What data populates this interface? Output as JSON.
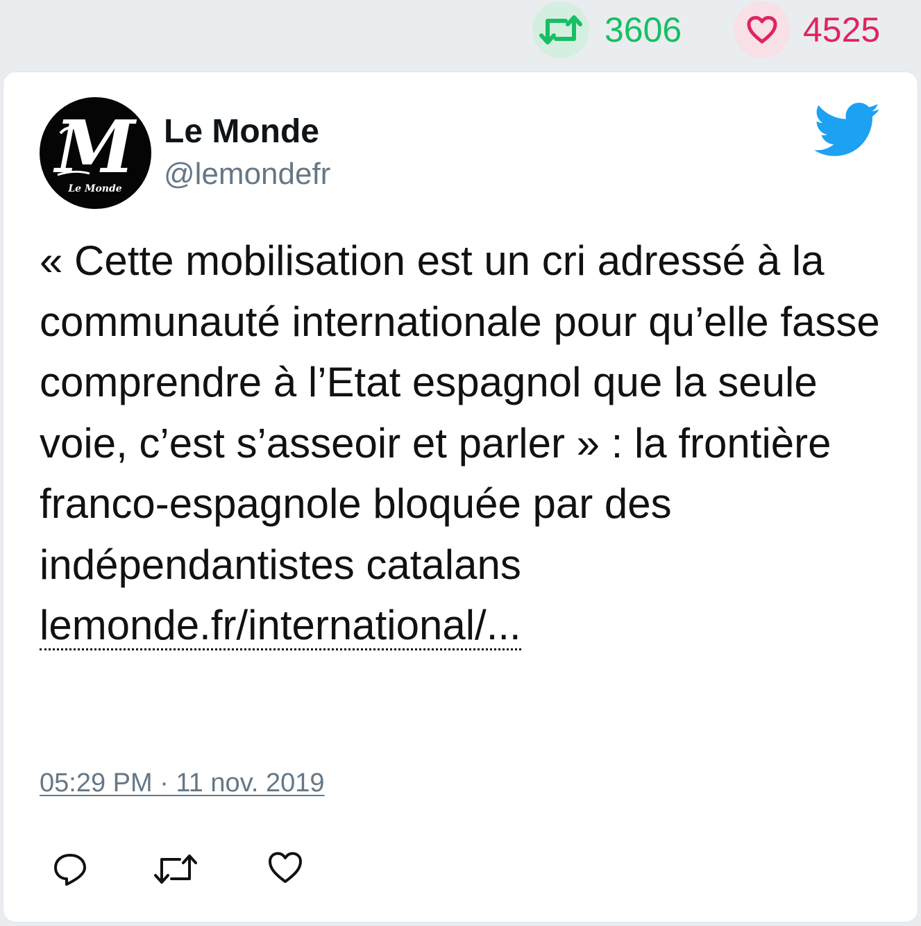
{
  "stats": {
    "retweet_icon": "retweet-icon",
    "retweet_count": "3606",
    "like_icon": "heart-icon",
    "like_count": "4525",
    "retweet_color": "#17bf63",
    "like_color": "#e0245e"
  },
  "tweet": {
    "display_name": "Le Monde",
    "handle": "@lemondefr",
    "avatar_text": "Le Monde",
    "logo_icon": "twitter-bird-icon",
    "text": "« Cette mobilisation est un cri adressé à la communauté internationale pour qu’elle fasse comprendre à l’Etat espagnol que la seule voie, c’est s’asseoir et parler » : la frontière franco-espagnole bloquée par des indépendantistes catalans",
    "link": "lemonde.fr/international/...",
    "timestamp": "05:29 PM · 11 nov. 2019"
  },
  "actions": [
    "reply-icon",
    "retweet-icon",
    "like-icon"
  ],
  "colors": {
    "background": "#eaedf0",
    "twitter_blue": "#1da1f2",
    "secondary_text": "#657786"
  }
}
